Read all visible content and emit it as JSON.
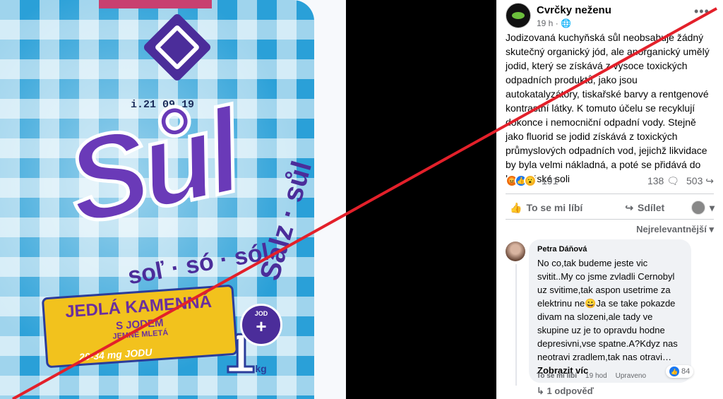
{
  "photo": {
    "lot_number": "i.21 09 19",
    "brand": "Sůl",
    "side_text": "Salz · sůl",
    "languages": "soľ · só · sól",
    "label_line1": "JEDLÁ KAMENNÁ",
    "label_line2": "S JODEM",
    "label_line3": "JEMNĚ MLETÁ",
    "iodine_range": "20-34 mg JODU",
    "weight": "1",
    "weight_unit": "kg"
  },
  "post": {
    "page_name": "Cvrčky neženu",
    "time": "19 h · ",
    "text": "Jodizovaná kuchyňská sůl neobsahuje žádný skutečný organický jód, ale anorganický umělý jodid, který se získává z vysoce toxických odpadních produktů, jako jsou autokatalyzátory, tiskařské barvy a rentgenové kontrastní látky. K tomuto účelu se recyklují dokonce i nemocniční odpadní vody. Stejně jako fluorid se jodid získává z toxických průmyslových odpadních vod, jejichž likvidace by byla velmi nákladná, a poté se přidává do kuchyňské soli",
    "reaction_count": "191",
    "comment_count": "138",
    "share_count": "503",
    "like_label": "To se mi líbí",
    "share_label": "Sdílet",
    "sort_label": "Nejrelevantnější"
  },
  "comment": {
    "author": "Petra Dáňová",
    "text": "No co,tak budeme jeste vic svitit..My co jsme zvladli Cernobyl uz svitime,tak aspon usetrime za elektrinu ne😀Ja se take pokazde divam na slozeni,ale tady ve skupine uz je to opravdu hodne depresivni,vse spatne.A?Kdyz nas neotravi zradlem,tak nas otravi…",
    "more_label": "Zobrazit víc",
    "like_label": "To se mi líbí",
    "age": "19 hod",
    "edited": "Upraveno",
    "reaction_count": "84",
    "replies": "1 odpověď"
  },
  "colors": {
    "facebook_blue": "#1877f2",
    "strike_red": "#e3202a",
    "bag_blue": "#2aa0d8",
    "brand_purple": "#6a3ab8"
  }
}
